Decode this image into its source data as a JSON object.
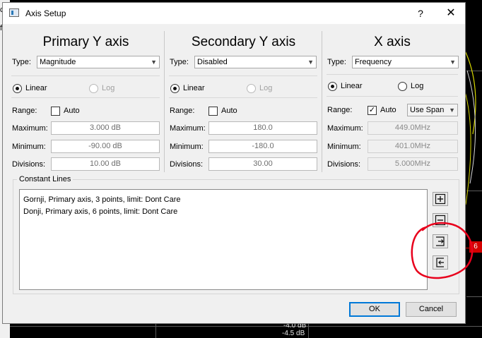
{
  "window": {
    "title": "Axis Setup",
    "help": "?",
    "close": "✕"
  },
  "labels": {
    "type": "Type:",
    "linear": "Linear",
    "log": "Log",
    "range": "Range:",
    "auto": "Auto",
    "maximum": "Maximum:",
    "minimum": "Minimum:",
    "divisions": "Divisions:"
  },
  "primary": {
    "heading": "Primary Y axis",
    "type": "Magnitude",
    "scale": "Linear",
    "auto": false,
    "maximum": "3.000 dB",
    "minimum": "-90.00 dB",
    "divisions": "10.00 dB"
  },
  "secondary": {
    "heading": "Secondary Y axis",
    "type": "Disabled",
    "scale": "Linear",
    "auto": false,
    "maximum": "180.0",
    "minimum": "-180.0",
    "divisions": "30.00"
  },
  "xaxis": {
    "heading": "X axis",
    "type": "Frequency",
    "scale": "Linear",
    "auto": true,
    "auto_check": "✓",
    "span_mode": "Use Span",
    "maximum": "449.0MHz",
    "minimum": "401.0MHz",
    "divisions": "5.000MHz"
  },
  "constant_lines": {
    "label": "Constant Lines",
    "items": [
      "Gornji, Primary axis, 3 points, limit: Dont Care",
      "Donji, Primary axis, 6 points, limit: Dont Care"
    ],
    "buttons": [
      "plus-box-icon",
      "minus-box-icon",
      "export-icon",
      "import-icon"
    ]
  },
  "footer": {
    "ok": "OK",
    "cancel": "Cancel"
  },
  "background": {
    "y_labels": [
      "-4.0 dB",
      "-4.5 dB"
    ],
    "red_marker": "6",
    "left_fragments": [
      "ce",
      "fi"
    ]
  },
  "colors": {
    "annotation": "#e8001c",
    "default_button": "#0078d7",
    "marker": "#d40000"
  }
}
